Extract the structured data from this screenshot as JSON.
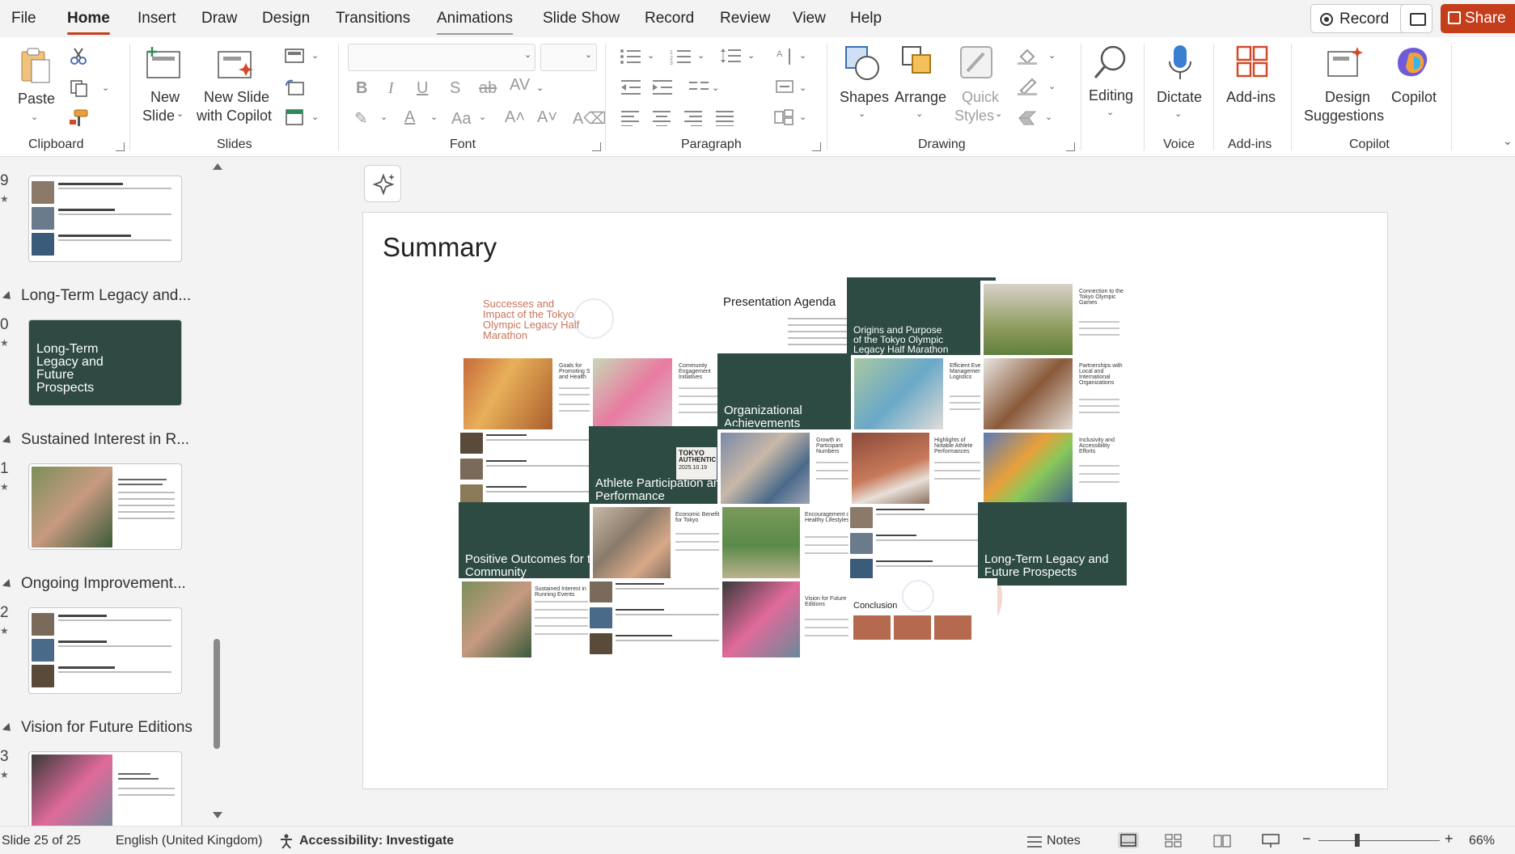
{
  "menu": {
    "tabs": [
      "File",
      "Home",
      "Insert",
      "Draw",
      "Design",
      "Transitions",
      "Animations",
      "Slide Show",
      "Record",
      "Review",
      "View",
      "Help"
    ],
    "active_tab": "Home",
    "record_button": "Record",
    "share_button": "Share"
  },
  "ribbon": {
    "clipboard": {
      "paste": "Paste",
      "group": "Clipboard"
    },
    "slides": {
      "new_slide": "New Slide",
      "new_slide_copilot": "New Slide with Copilot",
      "new_slide_l1": "New",
      "new_slide_l2": "Slide",
      "copilot_l1": "New Slide",
      "copilot_l2": "with Copilot",
      "group": "Slides"
    },
    "font": {
      "group": "Font"
    },
    "paragraph": {
      "group": "Paragraph"
    },
    "drawing": {
      "shapes": "Shapes",
      "arrange": "Arrange",
      "quick_styles_l1": "Quick",
      "quick_styles_l2": "Styles",
      "group": "Drawing"
    },
    "editing": {
      "label": "Editing"
    },
    "voice": {
      "dictate": "Dictate",
      "group": "Voice"
    },
    "addins": {
      "label": "Add-ins",
      "group": "Add-ins"
    },
    "copilot": {
      "design_l1": "Design",
      "design_l2": "Suggestions",
      "copilot": "Copilot",
      "group": "Copilot"
    }
  },
  "thumbnail_pane": {
    "items": [
      {
        "num": "9",
        "type": "slide"
      },
      {
        "section": "Long-Term Legacy and..."
      },
      {
        "num": "0",
        "title": "Long-Term Legacy and Future Prospects"
      },
      {
        "section": "Sustained Interest in R..."
      },
      {
        "num": "1",
        "title": "Sustained Interest in Running Events"
      },
      {
        "section": "Ongoing Improvement..."
      },
      {
        "num": "2",
        "title": ""
      },
      {
        "section": "Vision for Future Editions"
      },
      {
        "num": "3",
        "title": "Vision for Future Editions"
      }
    ],
    "star": "★"
  },
  "slide": {
    "title": "Summary",
    "tiles": {
      "t1_title": "Successes and Impact of the Tokyo Olympic Legacy Half Marathon",
      "t2_title": "Presentation Agenda",
      "t3_title": "Origins and Purpose of the Tokyo Olympic Legacy Half Marathon",
      "t4_title": "Connection to the Tokyo Olympic Games",
      "t5_title": "Goals for Promoting Sports and Health",
      "t6_title": "Community Engagement Initiatives",
      "t7_title": "Organizational Achievements",
      "t8_title": "Efficient Event Management and Logistics",
      "t9_title": "Partnerships with Local and International Organizations",
      "t10_title": "Athlete Participation and Performance",
      "t10_badge_l1": "TOKYO",
      "t10_badge_l2": "AUTHENTIC",
      "t10_badge_l3": "2025.10.19",
      "t11_title": "Growth in Participant Numbers",
      "t12_title": "Highlights of Notable Athlete Performances",
      "t13_title": "Inclusivity and Accessibility Efforts",
      "t14_title": "Positive Outcomes for the Community",
      "t15_title": "Economic Benefits for Tokyo",
      "t16_title": "Encouragement of Healthy Lifestyles",
      "t17_title": "Long-Term Legacy and Future Prospects",
      "t18_title": "Sustained Interest in Running Events",
      "t19_title": "Vision for Future Editions",
      "t20_title": "Conclusion"
    }
  },
  "status": {
    "slide_counter": "Slide 25 of 25",
    "language": "English (United Kingdom)",
    "accessibility": "Accessibility: Investigate",
    "notes": "Notes",
    "zoom": "66%"
  },
  "colors": {
    "accent": "#c43e1c",
    "dark_green": "#2d4a43",
    "terracotta": "#b5694e"
  }
}
